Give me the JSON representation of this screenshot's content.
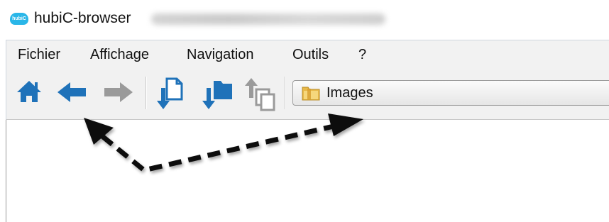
{
  "window": {
    "title": "hubiC-browser",
    "icon_label": "hubiC"
  },
  "menu": {
    "items": [
      "Fichier",
      "Affichage",
      "Navigation",
      "Outils",
      "?"
    ]
  },
  "toolbar": {
    "buttons": [
      "home-icon",
      "back-arrow-icon",
      "forward-arrow-icon",
      "upload-file-icon",
      "upload-folder-icon",
      "move-up-icon"
    ]
  },
  "address_bar": {
    "value": "Images",
    "icon": "folder-icon"
  },
  "colors": {
    "accent_blue": "#1f72b9",
    "disabled_gray": "#9a9a9a",
    "folder_yellow": "#e8b94a"
  }
}
